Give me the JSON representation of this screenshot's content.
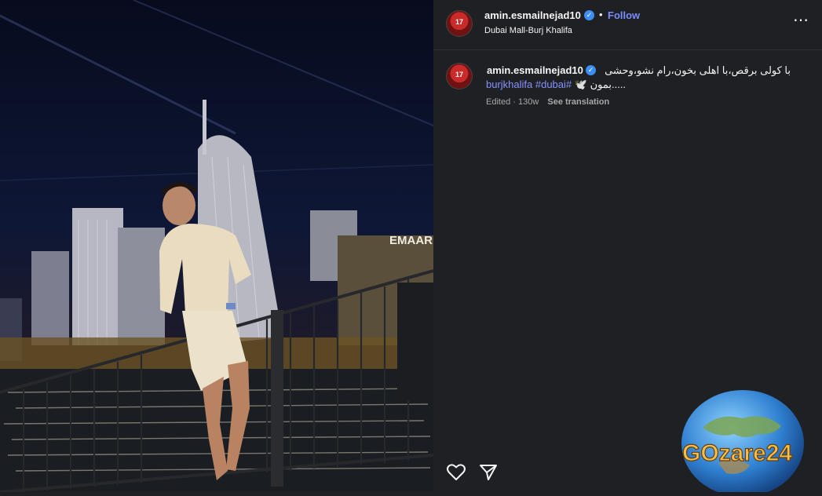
{
  "post": {
    "username": "amin.esmailnejad10",
    "follow_label": "Follow",
    "separator": "•",
    "location": "Dubai Mall-Burj Khalifa",
    "more_label": "⋯",
    "avatar_number": "17"
  },
  "caption": {
    "username": "amin.esmailnejad10",
    "line1": "با کولی برقص،با اهلی بخون،رام نشو،وحشی",
    "line2_tags": "burjkhalifa #dubai#",
    "line2_text": "بمون.....",
    "line2_emoji": "🕊️",
    "edited": "Edited",
    "meta_sep": "·",
    "age": "130w",
    "translate": "See translation"
  },
  "photo": {
    "sign_text": "EMAAR"
  },
  "watermark": {
    "text": "GOzare24"
  },
  "colors": {
    "bg": "#1f2023",
    "link": "#7b8cff",
    "verified": "#3d8ef3"
  },
  "icons": {
    "like": "heart-icon",
    "share": "paper-plane-icon",
    "verified": "verified-badge-icon",
    "more": "more-options-icon"
  }
}
